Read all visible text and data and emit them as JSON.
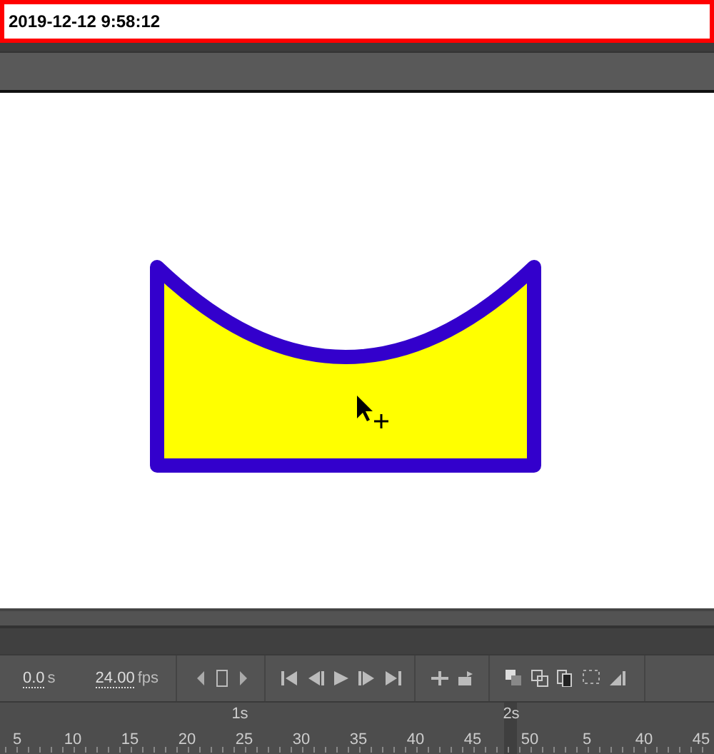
{
  "title_bar": {
    "text": "2019-12-12 9:58:12"
  },
  "timeline": {
    "time": {
      "value": "0.0",
      "unit": "s"
    },
    "fps": {
      "value": "24.00",
      "unit": "fps"
    },
    "ruler": {
      "markers": [
        "1s",
        "2s"
      ],
      "labels": [
        "5",
        "10",
        "15",
        "20",
        "25",
        "30",
        "35",
        "40",
        "45",
        "50",
        "5",
        "40",
        "45"
      ]
    }
  }
}
